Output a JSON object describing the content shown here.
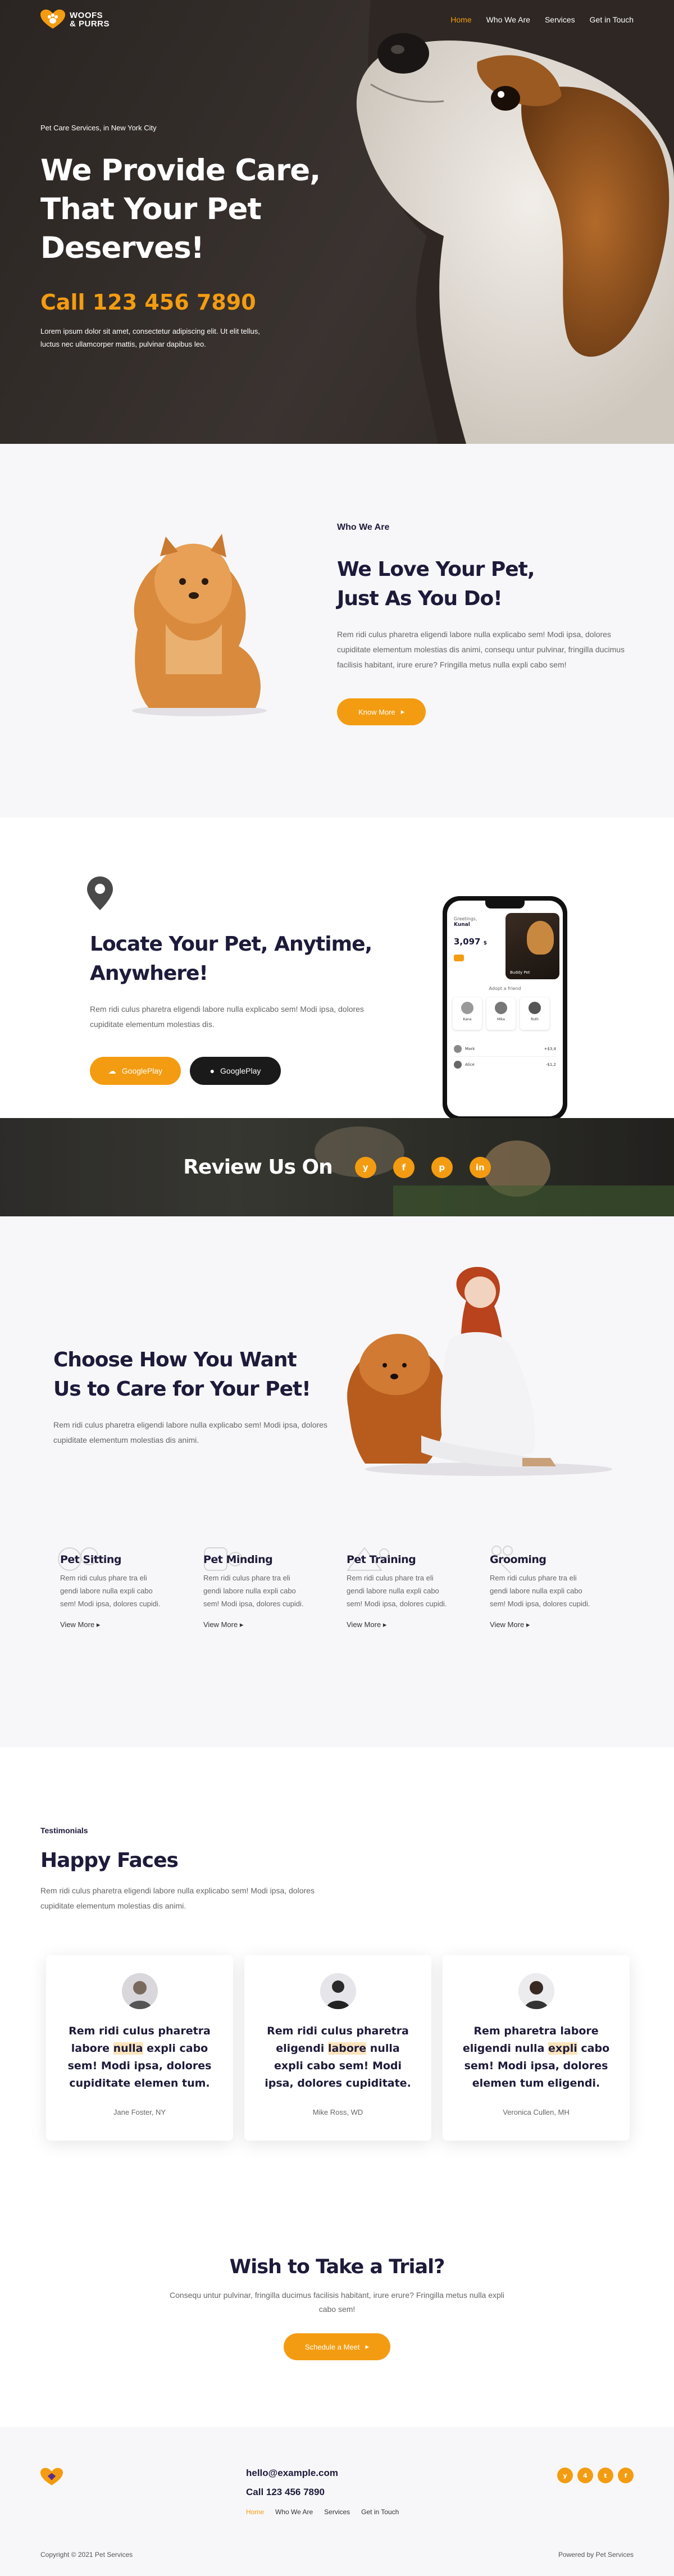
{
  "brand": {
    "line1": "WOOFS",
    "line2": "& PURRS",
    "accent": "#f39c12",
    "dark": "#1d1a3a"
  },
  "nav": {
    "items": [
      "Home",
      "Who We Are",
      "Services",
      "Get in Touch"
    ],
    "active": "Home"
  },
  "hero": {
    "kicker": "Pet Care Services, in New York City",
    "title_line1": "We Provide Care,",
    "title_line2": "That Your Pet",
    "title_line3": "Deserves!",
    "phone": "Call 123 456 7890",
    "text_line1": "Lorem ipsum dolor sit amet, consectetur adipiscing elit. Ut elit tellus,",
    "text_line2": "luctus nec ullamcorper mattis, pulvinar dapibus leo."
  },
  "who": {
    "kicker": "Who We Are",
    "title_line1": "We Love Your Pet,",
    "title_line2": "Just As You Do!",
    "text": "Rem ridi culus pharetra eligendi labore nulla explicabo sem! Modi ipsa, dolores cupiditate elementum molestias dis animi, consequ untur pulvinar, fringilla ducimus facilisis habitant, irure erure? Fringilla metus nulla expli cabo sem!",
    "button": "Know More"
  },
  "app": {
    "title_line1": "Locate Your Pet, Anytime,",
    "title_line2": "Anywhere!",
    "text": "Rem ridi culus pharetra eligendi labore nulla explicabo sem! Modi ipsa, dolores cupiditate elementum molestias dis.",
    "button_android": "GooglePlay",
    "button_apple": "GooglePlay",
    "phone_screen": {
      "greeting": "Greetings,",
      "user": "Kunal",
      "amount": "3,097",
      "unit": "$",
      "list_title": "Adopt a friend",
      "pet_tag": "Buddy Pet",
      "contacts": [
        "Kana",
        "Mika",
        "Ruth"
      ],
      "rows": [
        {
          "name": "Mark",
          "amount": "+$3,4"
        },
        {
          "name": "Alice",
          "amount": "-$1,2"
        }
      ]
    }
  },
  "review": {
    "title": "Review Us On",
    "icons": [
      "yelp-icon",
      "facebook-icon",
      "pinterest-icon",
      "linkedin-icon"
    ],
    "glyphs": [
      "y",
      "f",
      "p",
      "in"
    ]
  },
  "services": {
    "title_line1": "Choose How You Want",
    "title_line2": "Us to Care for Your Pet!",
    "text": "Rem ridi culus pharetra eligendi labore nulla explicabo sem! Modi ipsa, dolores cupiditate elementum molestias dis animi.",
    "items": [
      {
        "title": "Pet Sitting",
        "text": "Rem ridi culus phare tra eli gendi labore nulla expli cabo sem! Modi ipsa, dolores cupidi.",
        "link": "View More"
      },
      {
        "title": "Pet Minding",
        "text": "Rem ridi culus phare tra eli gendi labore nulla expli cabo sem! Modi ipsa, dolores cupidi.",
        "link": "View More"
      },
      {
        "title": "Pet Training",
        "text": "Rem ridi culus phare tra eli gendi labore nulla expli cabo sem! Modi ipsa, dolores cupidi.",
        "link": "View More"
      },
      {
        "title": "Grooming",
        "text": "Rem ridi culus phare tra eli gendi labore nulla expli cabo sem! Modi ipsa, dolores cupidi.",
        "link": "View More"
      }
    ]
  },
  "testimonials": {
    "kicker": "Testimonials",
    "title": "Happy Faces",
    "text": "Rem ridi culus pharetra eligendi labore nulla explicabo sem! Modi ipsa, dolores cupiditate elementum molestias dis animi.",
    "cards": [
      {
        "pre": "Rem ridi culus pharetra labore ",
        "mark": "nulla",
        "post": " expli cabo sem! Modi ipsa, dolores cupiditate elemen tum.",
        "name": "Jane Foster, NY"
      },
      {
        "pre": "Rem ridi culus pharetra eligendi ",
        "mark": "labore",
        "post": " nulla expli cabo sem! Modi ipsa, dolores cupiditate.",
        "name": "Mike Ross, WD"
      },
      {
        "pre": "Rem pharetra labore eligendi nulla ",
        "mark": "expli",
        "post": " cabo sem! Modi ipsa, dolores elemen tum eligendi.",
        "name": "Veronica Cullen, MH"
      }
    ]
  },
  "cta": {
    "title": "Wish to Take a Trial?",
    "text": "Consequ untur pulvinar, fringilla ducimus facilisis habitant, irure erure? Fringilla metus nulla expli cabo sem!",
    "button": "Schedule a Meet"
  },
  "footer": {
    "email": "hello@example.com",
    "phone": "Call 123 456 7890",
    "nav": [
      "Home",
      "Who We Are",
      "Services",
      "Get in Touch"
    ],
    "copyright": "Copyright © 2021 Pet Services",
    "powered": "Powered by Pet Services",
    "social_icons": [
      "yelp-icon",
      "foursquare-icon",
      "twitter-icon",
      "facebook-icon"
    ],
    "social_glyphs": [
      "y",
      "4",
      "t",
      "f"
    ]
  }
}
